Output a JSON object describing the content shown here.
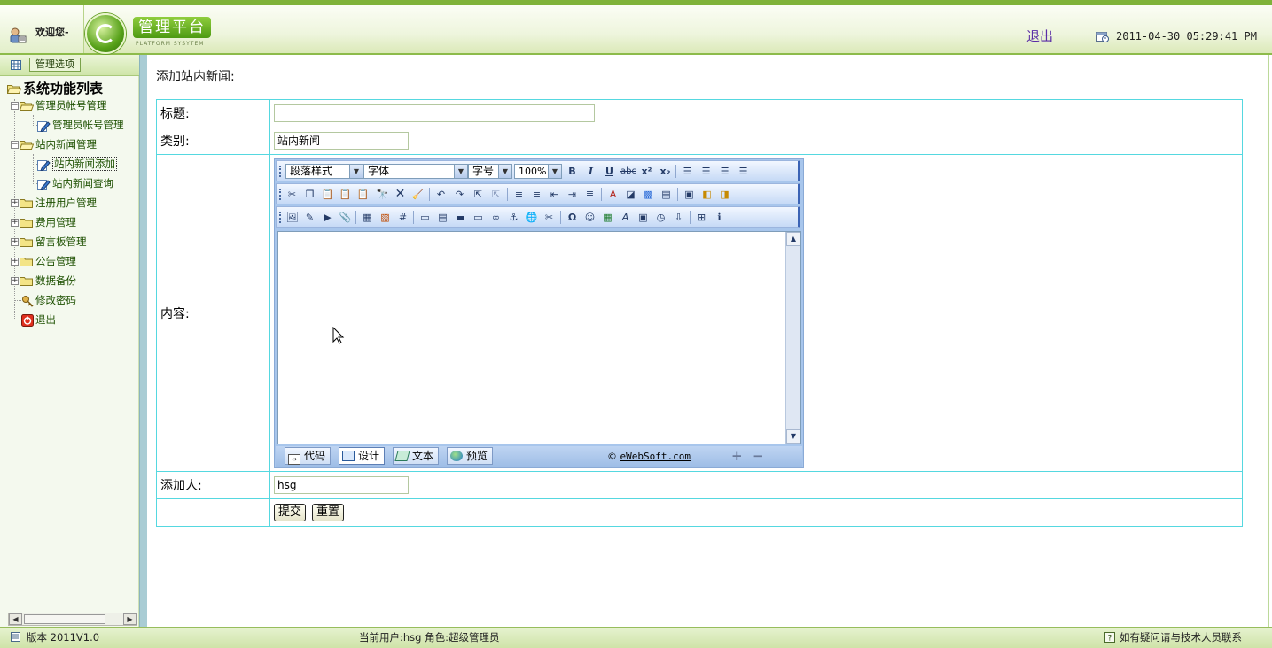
{
  "header": {
    "welcome": "欢迎您-",
    "brand_title": "管理平台",
    "brand_subtitle": "PLATFORM SYSYTEM",
    "logout": "退出",
    "datetime": "2011-04-30 05:29:41 PM"
  },
  "sidebar": {
    "menu_button": "管理选项",
    "root": "系统功能列表",
    "items": [
      {
        "label": "管理员帐号管理",
        "expanded": true,
        "children": [
          "管理员帐号管理"
        ]
      },
      {
        "label": "站内新闻管理",
        "expanded": true,
        "children": [
          "站内新闻添加",
          "站内新闻查询"
        ]
      },
      {
        "label": "注册用户管理",
        "expanded": false
      },
      {
        "label": "费用管理",
        "expanded": false
      },
      {
        "label": "留言板管理",
        "expanded": false
      },
      {
        "label": "公告管理",
        "expanded": false
      },
      {
        "label": "数据备份",
        "expanded": false
      }
    ],
    "leaf_items": [
      "修改密码",
      "退出"
    ]
  },
  "main": {
    "page_title": "添加站内新闻:",
    "fields": {
      "title_label": "标题:",
      "title_value": "",
      "category_label": "类别:",
      "category_value": "站内新闻",
      "content_label": "内容:",
      "author_label": "添加人:",
      "author_value": "hsg"
    },
    "submit_label": "提交",
    "reset_label": "重置"
  },
  "editor": {
    "paragraph_style": "段落样式",
    "font": "字体",
    "font_size": "字号",
    "zoom": "100%",
    "modes": [
      {
        "label": "代码",
        "active": false
      },
      {
        "label": "设计",
        "active": true
      },
      {
        "label": "文本",
        "active": false
      },
      {
        "label": "预览",
        "active": false
      }
    ],
    "copyright_symbol": "©",
    "copyright_link": "eWebSoft.com",
    "toolbar1": [
      "bold-icon",
      "italic-icon",
      "underline-icon",
      "strikethrough-icon",
      "superscript-icon",
      "subscript-icon",
      "align-left-icon",
      "align-center-icon",
      "align-right-icon",
      "align-justify-icon"
    ],
    "toolbar2": [
      "cut-icon",
      "copy-icon",
      "paste-icon",
      "paste-text-icon",
      "paste-word-icon",
      "find-icon",
      "delete-icon",
      "clean-format-icon",
      "undo-icon",
      "redo-icon",
      "select-all-icon",
      "unselect-icon",
      "ordered-list-icon",
      "unordered-list-icon",
      "outdent-icon",
      "indent-icon",
      "clear-float-icon",
      "font-color-icon",
      "background-color-icon",
      "highlight-icon",
      "text-box-icon",
      "fullscreen-icon",
      "page-break-icon",
      "format-brush-icon"
    ],
    "toolbar3": [
      "image-icon",
      "flash-icon",
      "media-icon",
      "attachment-icon",
      "table-icon",
      "cell-icon",
      "grid-icon",
      "fieldset-icon",
      "iframe-icon",
      "horizontal-rule-icon",
      "marquee-icon",
      "hyperlink-icon",
      "anchor-icon",
      "map-icon",
      "unlink-icon",
      "special-char-icon",
      "emoticon-icon",
      "excel-icon",
      "art-text-icon",
      "date-icon",
      "time-icon",
      "remote-upload-icon",
      "maximize-icon",
      "about-icon"
    ]
  },
  "footer": {
    "version": "版本 2011V1.0",
    "current_user": "当前用户:hsg  角色:超级管理员",
    "help": "如有疑问请与技术人员联系"
  },
  "colors": {
    "accent": "#7fb23a",
    "link": "#5a2ca6",
    "table_border": "#55d8e0",
    "editor_blue": "#a8c6ec"
  }
}
